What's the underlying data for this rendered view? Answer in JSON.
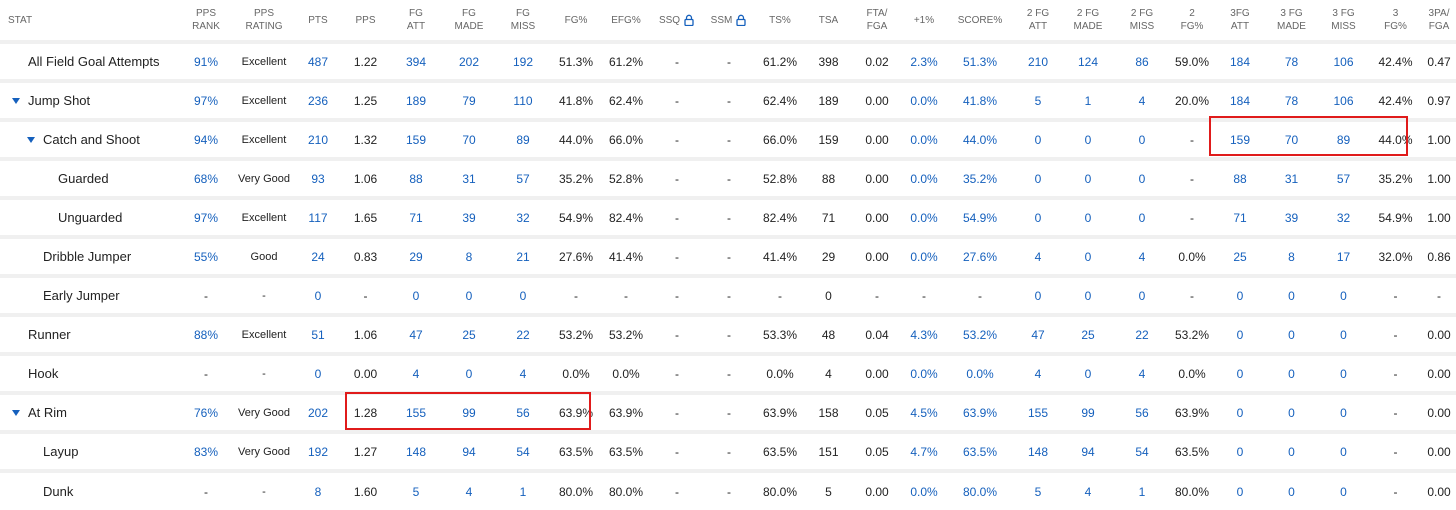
{
  "columns": [
    {
      "key": "stat",
      "lines": [
        "STAT"
      ],
      "lock": false
    },
    {
      "key": "pps_rank",
      "lines": [
        "PPS",
        "RANK"
      ],
      "lock": false
    },
    {
      "key": "pps_rating",
      "lines": [
        "PPS",
        "RATING"
      ],
      "lock": false
    },
    {
      "key": "pts",
      "lines": [
        "PTS"
      ],
      "lock": false
    },
    {
      "key": "pps",
      "lines": [
        "PPS"
      ],
      "lock": false
    },
    {
      "key": "fg_att",
      "lines": [
        "FG",
        "ATT"
      ],
      "lock": false
    },
    {
      "key": "fg_made",
      "lines": [
        "FG",
        "MADE"
      ],
      "lock": false
    },
    {
      "key": "fg_miss",
      "lines": [
        "FG",
        "MISS"
      ],
      "lock": false
    },
    {
      "key": "fg_pct",
      "lines": [
        "FG%"
      ],
      "lock": false
    },
    {
      "key": "efg_pct",
      "lines": [
        "EFG%"
      ],
      "lock": false
    },
    {
      "key": "ssq",
      "lines": [
        "SSQ"
      ],
      "lock": true
    },
    {
      "key": "ssm",
      "lines": [
        "SSM"
      ],
      "lock": true
    },
    {
      "key": "ts_pct",
      "lines": [
        "TS%"
      ],
      "lock": false
    },
    {
      "key": "tsa",
      "lines": [
        "TSA"
      ],
      "lock": false
    },
    {
      "key": "fta_fga",
      "lines": [
        "FTA/",
        "FGA"
      ],
      "lock": false
    },
    {
      "key": "plus1",
      "lines": [
        "+1%"
      ],
      "lock": false
    },
    {
      "key": "score_pct",
      "lines": [
        "SCORE%"
      ],
      "lock": false
    },
    {
      "key": "fg2_att",
      "lines": [
        "2 FG",
        "ATT"
      ],
      "lock": false
    },
    {
      "key": "fg2_made",
      "lines": [
        "2 FG",
        "MADE"
      ],
      "lock": false
    },
    {
      "key": "fg2_miss",
      "lines": [
        "2 FG",
        "MISS"
      ],
      "lock": false
    },
    {
      "key": "fg2_pct",
      "lines": [
        "2",
        "FG%"
      ],
      "lock": false
    },
    {
      "key": "fg3_att",
      "lines": [
        "3FG",
        "ATT"
      ],
      "lock": false
    },
    {
      "key": "fg3_made",
      "lines": [
        "3 FG",
        "MADE"
      ],
      "lock": false
    },
    {
      "key": "fg3_miss",
      "lines": [
        "3 FG",
        "MISS"
      ],
      "lock": false
    },
    {
      "key": "fg3_pct",
      "lines": [
        "3",
        "FG%"
      ],
      "lock": false
    },
    {
      "key": "pa3_fga",
      "lines": [
        "3PA/",
        "FGA"
      ],
      "lock": false
    }
  ],
  "rows": [
    {
      "name": "All Field Goal Attempts",
      "level": 0,
      "expandable": false,
      "cells": [
        "91%",
        "Excellent",
        "487",
        "1.22",
        "394",
        "202",
        "192",
        "51.3%",
        "61.2%",
        "-",
        "-",
        "61.2%",
        "398",
        "0.02",
        "2.3%",
        "51.3%",
        "210",
        "124",
        "86",
        "59.0%",
        "184",
        "78",
        "106",
        "42.4%",
        "0.47"
      ]
    },
    {
      "name": "Jump Shot",
      "level": 0,
      "expandable": true,
      "cells": [
        "97%",
        "Excellent",
        "236",
        "1.25",
        "189",
        "79",
        "110",
        "41.8%",
        "62.4%",
        "-",
        "-",
        "62.4%",
        "189",
        "0.00",
        "0.0%",
        "41.8%",
        "5",
        "1",
        "4",
        "20.0%",
        "184",
        "78",
        "106",
        "42.4%",
        "0.97"
      ]
    },
    {
      "name": "Catch and Shoot",
      "level": 1,
      "expandable": true,
      "cells": [
        "94%",
        "Excellent",
        "210",
        "1.32",
        "159",
        "70",
        "89",
        "44.0%",
        "66.0%",
        "-",
        "-",
        "66.0%",
        "159",
        "0.00",
        "0.0%",
        "44.0%",
        "0",
        "0",
        "0",
        "-",
        "159",
        "70",
        "89",
        "44.0%",
        "1.00"
      ]
    },
    {
      "name": "Guarded",
      "level": 2,
      "expandable": false,
      "cells": [
        "68%",
        "Very Good",
        "93",
        "1.06",
        "88",
        "31",
        "57",
        "35.2%",
        "52.8%",
        "-",
        "-",
        "52.8%",
        "88",
        "0.00",
        "0.0%",
        "35.2%",
        "0",
        "0",
        "0",
        "-",
        "88",
        "31",
        "57",
        "35.2%",
        "1.00"
      ]
    },
    {
      "name": "Unguarded",
      "level": 2,
      "expandable": false,
      "cells": [
        "97%",
        "Excellent",
        "117",
        "1.65",
        "71",
        "39",
        "32",
        "54.9%",
        "82.4%",
        "-",
        "-",
        "82.4%",
        "71",
        "0.00",
        "0.0%",
        "54.9%",
        "0",
        "0",
        "0",
        "-",
        "71",
        "39",
        "32",
        "54.9%",
        "1.00"
      ]
    },
    {
      "name": "Dribble Jumper",
      "level": 1,
      "expandable": false,
      "cells": [
        "55%",
        "Good",
        "24",
        "0.83",
        "29",
        "8",
        "21",
        "27.6%",
        "41.4%",
        "-",
        "-",
        "41.4%",
        "29",
        "0.00",
        "0.0%",
        "27.6%",
        "4",
        "0",
        "4",
        "0.0%",
        "25",
        "8",
        "17",
        "32.0%",
        "0.86"
      ]
    },
    {
      "name": "Early Jumper",
      "level": 1,
      "expandable": false,
      "cells": [
        "-",
        "-",
        "0",
        "-",
        "0",
        "0",
        "0",
        "-",
        "-",
        "-",
        "-",
        "-",
        "0",
        "-",
        "-",
        "-",
        "0",
        "0",
        "0",
        "-",
        "0",
        "0",
        "0",
        "-",
        "-"
      ]
    },
    {
      "name": "Runner",
      "level": 0,
      "expandable": false,
      "cells": [
        "88%",
        "Excellent",
        "51",
        "1.06",
        "47",
        "25",
        "22",
        "53.2%",
        "53.2%",
        "-",
        "-",
        "53.3%",
        "48",
        "0.04",
        "4.3%",
        "53.2%",
        "47",
        "25",
        "22",
        "53.2%",
        "0",
        "0",
        "0",
        "-",
        "0.00"
      ]
    },
    {
      "name": "Hook",
      "level": 0,
      "expandable": false,
      "cells": [
        "-",
        "-",
        "0",
        "0.00",
        "4",
        "0",
        "4",
        "0.0%",
        "0.0%",
        "-",
        "-",
        "0.0%",
        "4",
        "0.00",
        "0.0%",
        "0.0%",
        "4",
        "0",
        "4",
        "0.0%",
        "0",
        "0",
        "0",
        "-",
        "0.00"
      ]
    },
    {
      "name": "At Rim",
      "level": 0,
      "expandable": true,
      "cells": [
        "76%",
        "Very Good",
        "202",
        "1.28",
        "155",
        "99",
        "56",
        "63.9%",
        "63.9%",
        "-",
        "-",
        "63.9%",
        "158",
        "0.05",
        "4.5%",
        "63.9%",
        "155",
        "99",
        "56",
        "63.9%",
        "0",
        "0",
        "0",
        "-",
        "0.00"
      ]
    },
    {
      "name": "Layup",
      "level": 1,
      "expandable": false,
      "cells": [
        "83%",
        "Very Good",
        "192",
        "1.27",
        "148",
        "94",
        "54",
        "63.5%",
        "63.5%",
        "-",
        "-",
        "63.5%",
        "151",
        "0.05",
        "4.7%",
        "63.5%",
        "148",
        "94",
        "54",
        "63.5%",
        "0",
        "0",
        "0",
        "-",
        "0.00"
      ]
    },
    {
      "name": "Dunk",
      "level": 1,
      "expandable": false,
      "cells": [
        "-",
        "-",
        "8",
        "1.60",
        "5",
        "4",
        "1",
        "80.0%",
        "80.0%",
        "-",
        "-",
        "80.0%",
        "5",
        "0.00",
        "0.0%",
        "80.0%",
        "5",
        "4",
        "1",
        "80.0%",
        "0",
        "0",
        "0",
        "-",
        "0.00"
      ]
    }
  ],
  "link_columns": [
    "pps_rank",
    "pts",
    "fg_att",
    "fg_made",
    "fg_miss",
    "plus1",
    "score_pct",
    "fg2_att",
    "fg2_made",
    "fg2_miss",
    "fg3_att",
    "fg3_made",
    "fg3_miss"
  ],
  "colors": {
    "link": "#1560bd",
    "highlight": "#e01b1b",
    "row_separator": "#f0f0f0"
  },
  "icons": {
    "expand": "caret-down-icon",
    "locked": "lock-icon"
  }
}
